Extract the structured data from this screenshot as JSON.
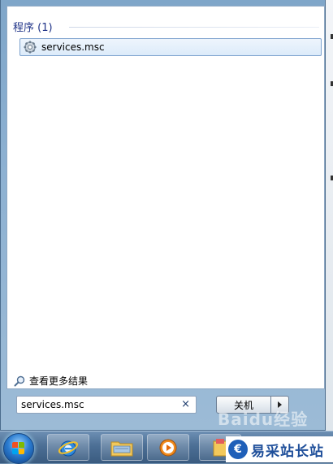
{
  "results": {
    "section_title": "程序 (1)",
    "items": [
      {
        "label": "services.msc",
        "icon": "gear-icon"
      }
    ]
  },
  "see_more": {
    "label": "查看更多结果",
    "icon": "search-icon"
  },
  "search": {
    "value": "services.msc",
    "clear_glyph": "×"
  },
  "power": {
    "shutdown_label": "关机",
    "options_icon": "triangle-right-icon"
  },
  "taskbar": {
    "apps": [
      {
        "name": "internet-explorer",
        "icon": "ie-icon"
      },
      {
        "name": "windows-explorer",
        "icon": "folder-icon"
      },
      {
        "name": "media-player",
        "icon": "media-icon"
      },
      {
        "name": "folder",
        "icon": "folder2-icon"
      }
    ]
  },
  "watermark": {
    "text": "Baidu经验"
  },
  "brand": {
    "logo_glyph": "€",
    "text": "易采站长站"
  },
  "colors": {
    "section_title": "#1e3287",
    "selection_border": "#7da2ce",
    "taskbar": "#4c6f95"
  }
}
